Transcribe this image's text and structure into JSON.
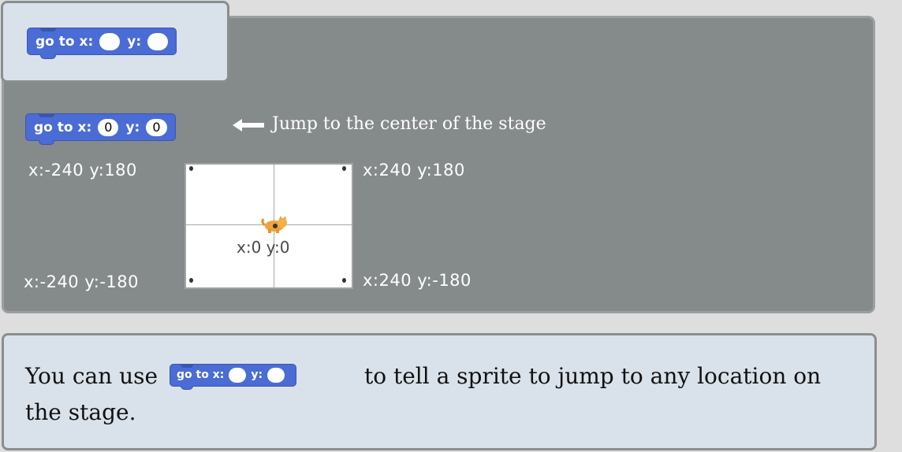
{
  "title_block": {
    "word_go_to": "go to x:",
    "word_y": "y:",
    "x_value": "",
    "y_value": ""
  },
  "example_block": {
    "word_go_to": "go to x:",
    "word_y": "y:",
    "x_value": "0",
    "y_value": "0"
  },
  "annotation": "Jump to the center of the stage",
  "stage": {
    "corners": {
      "top_left": "x:-240 y:180",
      "top_right": "x:240 y:180",
      "bottom_left": "x:-240 y:-180",
      "bottom_right": "x:240 y:-180"
    },
    "center": "x:0 y:0"
  },
  "caption": {
    "before": "You can use",
    "after": "to tell a sprite to jump to any location on the stage.",
    "block": {
      "word_go_to": "go to x:",
      "word_y": "y:",
      "x_value": "",
      "y_value": ""
    }
  },
  "colors": {
    "motion_block": "#4a6cd4",
    "panel_gray": "#858a8b",
    "panel_light": "#d9e2ea"
  },
  "icons": {
    "arrow": "left-arrow-icon",
    "sprite": "cat-sprite-icon"
  }
}
